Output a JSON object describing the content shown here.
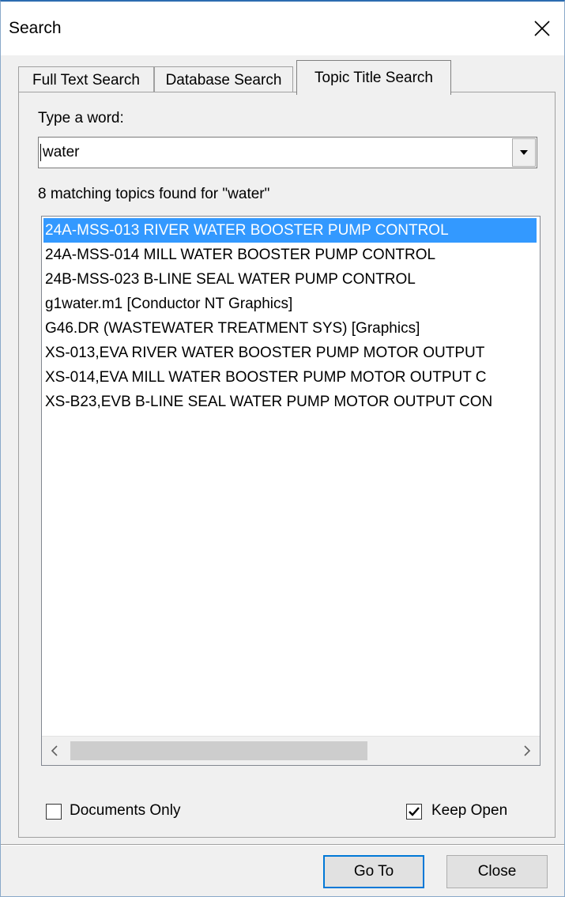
{
  "window": {
    "title": "Search"
  },
  "tabs": [
    {
      "label": "Full Text Search",
      "active": false
    },
    {
      "label": "Database Search",
      "active": false
    },
    {
      "label": "Topic Title Search",
      "active": true
    }
  ],
  "search": {
    "prompt_label": "Type a word:",
    "value": "water",
    "result_summary": "8 matching topics found for \"water\""
  },
  "results": [
    "24A-MSS-013 RIVER WATER BOOSTER PUMP CONTROL",
    "24A-MSS-014 MILL WATER BOOSTER PUMP CONTROL",
    "24B-MSS-023 B-LINE SEAL WATER PUMP CONTROL",
    "g1water.m1 [Conductor NT Graphics]",
    "G46.DR (WASTEWATER TREATMENT SYS) [Graphics]",
    "XS-013,EVA RIVER WATER BOOSTER PUMP MOTOR OUTPUT",
    "XS-014,EVA MILL WATER BOOSTER PUMP MOTOR OUTPUT C",
    "XS-B23,EVB B-LINE SEAL WATER PUMP MOTOR OUTPUT CON"
  ],
  "selected_index": 0,
  "options": {
    "documents_only": {
      "label": "Documents Only",
      "checked": false
    },
    "keep_open": {
      "label": "Keep Open",
      "checked": true
    }
  },
  "buttons": {
    "goto_label": "Go To",
    "close_label": "Close"
  },
  "colors": {
    "selection": "#3399ff",
    "default_button_border": "#0078d7"
  }
}
